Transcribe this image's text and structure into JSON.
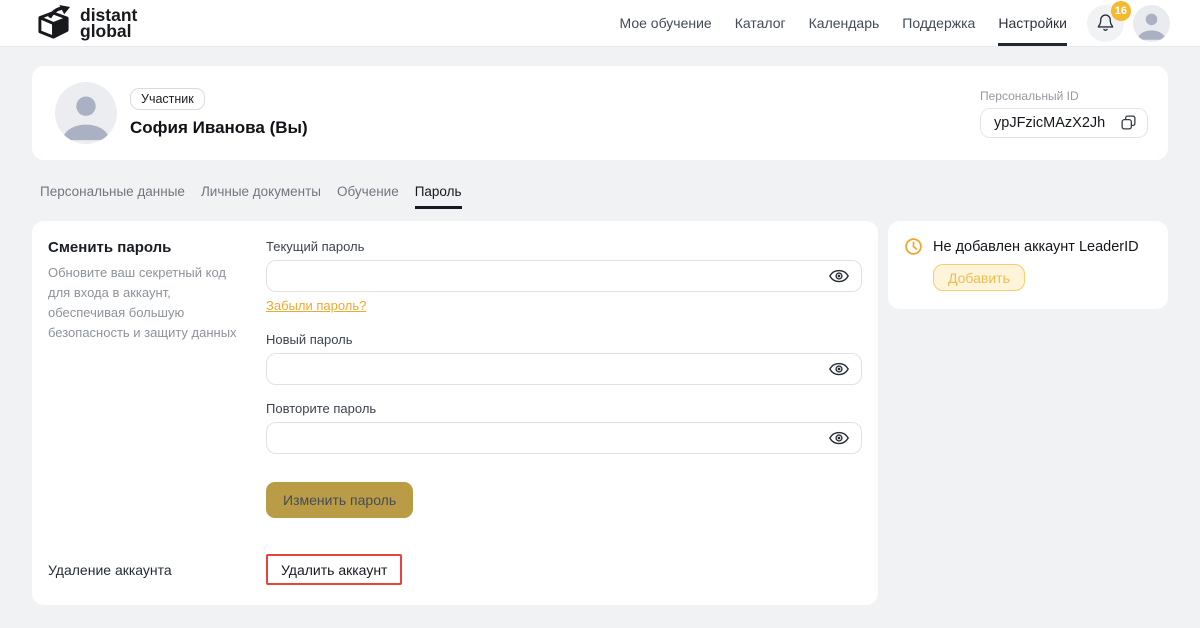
{
  "header": {
    "brand": {
      "line1": "distant",
      "line2": "global"
    },
    "nav": {
      "items": [
        {
          "label": "Мое обучение",
          "active": false
        },
        {
          "label": "Каталог",
          "active": false
        },
        {
          "label": "Календарь",
          "active": false
        },
        {
          "label": "Поддержка",
          "active": false
        },
        {
          "label": "Настройки",
          "active": true
        }
      ]
    },
    "notifications": {
      "count": "16"
    }
  },
  "profile_card": {
    "role_badge": "Участник",
    "name": "София Иванова (Вы)",
    "personal_id": {
      "label": "Персональный ID",
      "value": "ypJFzicMAzX2Jh"
    }
  },
  "tabs": {
    "items": [
      {
        "label": "Персональные данные",
        "active": false
      },
      {
        "label": "Личные документы",
        "active": false
      },
      {
        "label": "Обучение",
        "active": false
      },
      {
        "label": "Пароль",
        "active": true
      }
    ]
  },
  "password_card": {
    "title": "Сменить пароль",
    "description": "Обновите ваш секретный код для входа в аккаунт, обеспечивая большую безопасность и защиту данных",
    "fields": [
      {
        "label": "Текущий пароль",
        "value": "",
        "placeholder": ""
      },
      {
        "label": "Новый пароль",
        "value": "",
        "placeholder": ""
      },
      {
        "label": "Повторите пароль",
        "value": "",
        "placeholder": ""
      }
    ],
    "forgot_password_link": "Забыли пароль?",
    "submit_button": "Изменить пароль",
    "delete_section": {
      "label": "Удаление аккаунта",
      "button": "Удалить аккаунт"
    }
  },
  "leaderid_card": {
    "message": "Не добавлен аккаунт LeaderID",
    "add_button": "Добавить"
  },
  "icons": {
    "bell": "bell-icon",
    "copy": "copy-icon",
    "eye": "eye-icon",
    "clock": "clock-icon",
    "avatar": "person-silhouette"
  },
  "colors": {
    "page_bg": "#f1f2f4",
    "card_bg": "#ffffff",
    "accent_gold_button": "#b99c45",
    "accent_orange_link": "#f0a82f",
    "badge_yellow": "#f5b831",
    "add_button_bg": "#fdf4da",
    "add_button_border": "#f4cf70",
    "danger_red": "#e8423c",
    "tab_underline": "#17191e",
    "text_primary": "#15181d",
    "text_muted": "#8d929b"
  }
}
